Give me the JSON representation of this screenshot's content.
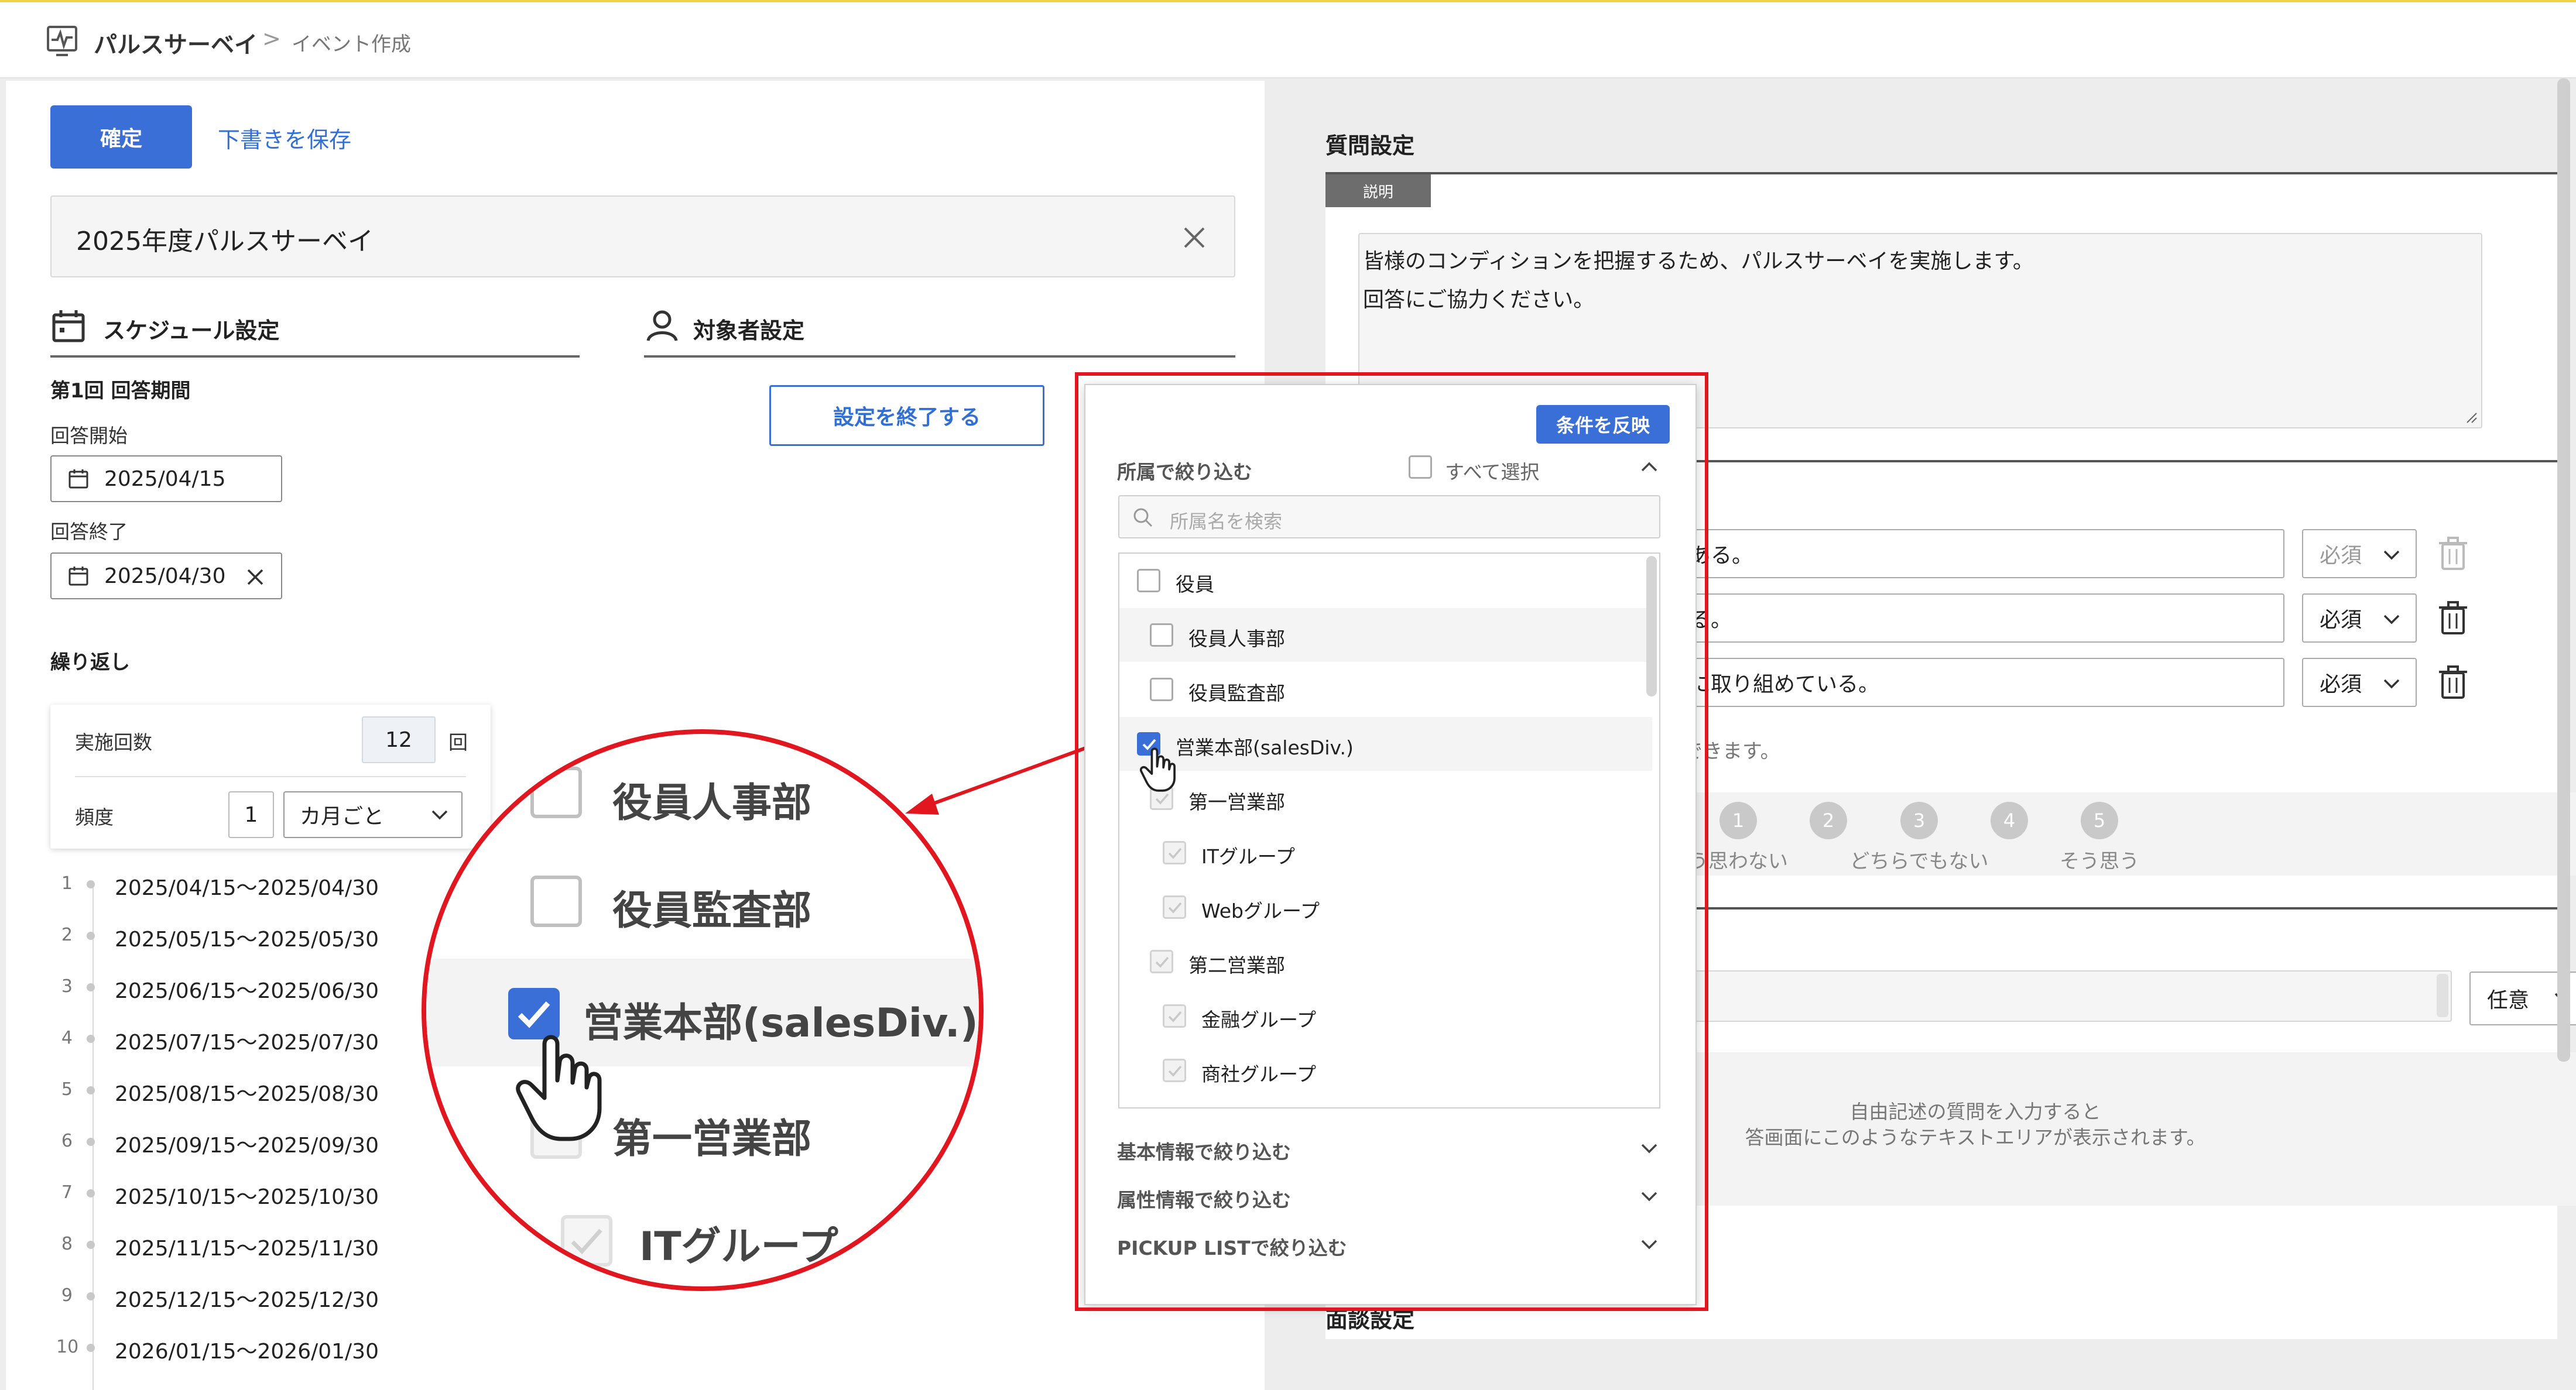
{
  "header": {
    "app_title": "パルスサーベイ",
    "separator": ">",
    "page_name": "イベント作成"
  },
  "actions": {
    "confirm_label": "確定",
    "save_draft_label": "下書きを保存"
  },
  "event_title": {
    "value": "2025年度パルスサーベイ"
  },
  "schedule": {
    "section_title": "スケジュール設定",
    "period_title": "第1回 回答期間",
    "start_label": "回答開始",
    "start_value": "2025/04/15",
    "end_label": "回答終了",
    "end_value": "2025/04/30",
    "repeat_title": "繰り返し",
    "count_label": "実施回数",
    "count_value": "12",
    "count_unit": "回",
    "freq_label": "頻度",
    "freq_value": "1",
    "freq_unit": "カ月ごと",
    "rounds": [
      {
        "idx": "1",
        "range": "2025/04/15〜2025/04/30"
      },
      {
        "idx": "2",
        "range": "2025/05/15〜2025/05/30"
      },
      {
        "idx": "3",
        "range": "2025/06/15〜2025/06/30"
      },
      {
        "idx": "4",
        "range": "2025/07/15〜2025/07/30"
      },
      {
        "idx": "5",
        "range": "2025/08/15〜2025/08/30"
      },
      {
        "idx": "6",
        "range": "2025/09/15〜2025/09/30"
      },
      {
        "idx": "7",
        "range": "2025/10/15〜2025/10/30"
      },
      {
        "idx": "8",
        "range": "2025/11/15〜2025/11/30"
      },
      {
        "idx": "9",
        "range": "2025/12/15〜2025/12/30"
      },
      {
        "idx": "10",
        "range": "2026/01/15〜2026/01/30"
      }
    ]
  },
  "target": {
    "section_title": "対象者設定",
    "finish_button": "設定を終了する"
  },
  "questions": {
    "section_title": "質問設定",
    "description_tab": "説明",
    "description_line1": "皆様のコンディションを把握するため、パルスサーベイを実施します。",
    "description_line2": "回答にご協力ください。",
    "items": [
      {
        "text_tail": "ある。",
        "required": "必須"
      },
      {
        "text_tail": "る。",
        "required": "必須"
      },
      {
        "text_tail": "に取り組めている。",
        "required": "必須"
      }
    ],
    "hint_tail": "できます。",
    "scale": [
      {
        "n": "1",
        "label": "う思わない"
      },
      {
        "n": "2",
        "label": ""
      },
      {
        "n": "3",
        "label": "どちらでもない"
      },
      {
        "n": "4",
        "label": ""
      },
      {
        "n": "5",
        "label": "そう思う"
      }
    ],
    "optional_label": "任意",
    "freeform_line1": "自由記述の質問を入力すると",
    "freeform_line2": "答画面にこのようなテキストエリアが表示されます。",
    "interview_title": "面談設定"
  },
  "filter_popup": {
    "apply_button": "条件を反映",
    "dept_filter_title": "所属で絞り込む",
    "select_all_label": "すべて選択",
    "search_placeholder": "所属名を検索",
    "tree": [
      {
        "label": "役員",
        "level": 0,
        "state": "unchecked"
      },
      {
        "label": "役員人事部",
        "level": 1,
        "state": "unchecked"
      },
      {
        "label": "役員監査部",
        "level": 1,
        "state": "unchecked"
      },
      {
        "label": "営業本部(salesDiv.)",
        "level": 0,
        "state": "checked"
      },
      {
        "label": "第一営業部",
        "level": 1,
        "state": "dim"
      },
      {
        "label": "ITグループ",
        "level": 2,
        "state": "dim"
      },
      {
        "label": "Webグループ",
        "level": 2,
        "state": "dim"
      },
      {
        "label": "第二営業部",
        "level": 1,
        "state": "dim"
      },
      {
        "label": "金融グループ",
        "level": 2,
        "state": "dim"
      },
      {
        "label": "商社グループ",
        "level": 2,
        "state": "dim"
      }
    ],
    "basic_filter_title": "基本情報で絞り込む",
    "attr_filter_title": "属性情報で絞り込む",
    "pickup_filter_title": "PICKUP LISTで絞り込む"
  },
  "zoom": {
    "row1": "役員人事部",
    "row2": "役員監査部",
    "row3": "営業本部(salesDiv.)",
    "row4": "第一営業部",
    "row5": "ITグループ"
  },
  "colors": {
    "primary": "#3a6fd8",
    "highlight_red": "#e2161f",
    "header_accent": "#f0d24a"
  }
}
